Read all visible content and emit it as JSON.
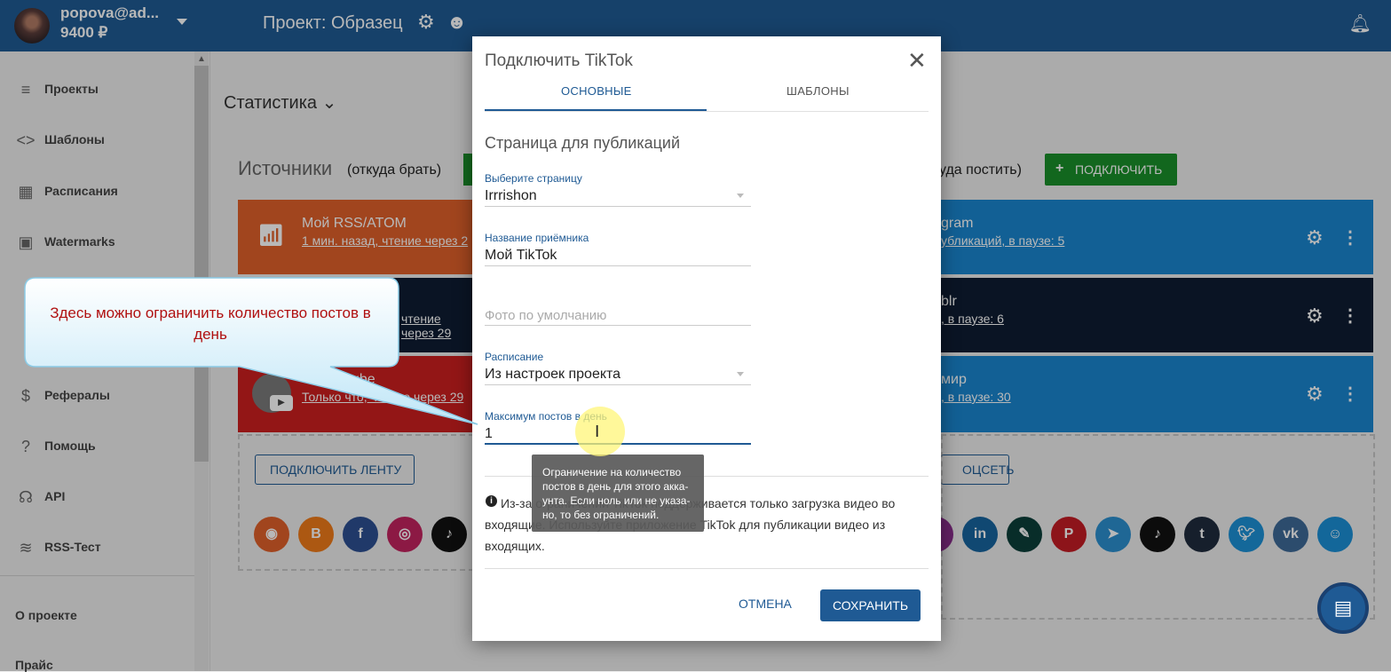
{
  "header": {
    "user": "popova@ad...",
    "balance": "9400 ₽",
    "project_title": "Проект: Образец"
  },
  "sidebar": {
    "items": [
      {
        "label": "Проекты",
        "icon": "list-icon"
      },
      {
        "label": "Шаблоны",
        "icon": "code-brackets-icon"
      },
      {
        "label": "Расписания",
        "icon": "calendar-icon"
      },
      {
        "label": "Watermarks",
        "icon": "watermark-icon"
      },
      {
        "label": "Рефералы",
        "icon": "dollar-icon"
      },
      {
        "label": "Помощь",
        "icon": "help-circle-icon"
      },
      {
        "label": "API",
        "icon": "antenna-icon"
      },
      {
        "label": "RSS-Тест",
        "icon": "rss-icon"
      }
    ],
    "about": "О проекте",
    "pricing": "Прайс"
  },
  "main": {
    "stats_title": "Статистика",
    "sources_title": "Источники",
    "sources_sub": "(откуда брать)",
    "dest_sub": "уда постить)",
    "connect_label": "ПОДКЛЮЧИТЬ",
    "sources": [
      {
        "title": "Мой RSS/ATOM",
        "sub": "1 мин. назад, чтение через 2",
        "color": "#e0602a"
      },
      {
        "title": "",
        "sub": "чтение через 29",
        "color": "#0f1d33"
      },
      {
        "title": "ube",
        "sub": "Только что, чтение через 29",
        "color": "#cc1f1f"
      }
    ],
    "destinations": [
      {
        "title": "gram",
        "sub": "убликаций, в паузе: 5",
        "color": "#1a86cf"
      },
      {
        "title": "blr",
        "sub": ", в паузе: 6",
        "color": "#0f1d33"
      },
      {
        "title": "мир",
        "sub": ", в паузе: 30",
        "color": "#1a86cf"
      }
    ],
    "connect_feed_label": "ПОДКЛЮЧИТЬ ЛЕНТУ",
    "connect_network_label": "ОЦСЕТЬ"
  },
  "modal": {
    "title": "Подключить TikTok",
    "tabs": [
      "ОСНОВНЫЕ",
      "ШАБЛОНЫ"
    ],
    "section_title": "Страница для публикаций",
    "page_label": "Выберите страницу",
    "page_value": "Irrrishon",
    "receiver_label": "Название приёмника",
    "receiver_value": "Мой TikTok",
    "photo_placeholder": "Фото по умолчанию",
    "schedule_label": "Расписание",
    "schedule_value": "Из настроек проекта",
    "max_label": "Максимум постов в день",
    "max_value": "1",
    "info_text": "Из-за ограничений TikTok поддерживается только загрузка видео во входящие. Используйте приложение TikTok для публикации видео из входящих.",
    "cancel_label": "ОТМЕНА",
    "save_label": "СОХРАНИТЬ"
  },
  "tooltip": "Ограничение на количество постов в день для этого акка-унта. Если ноль или не указа-но, то без ограничений.",
  "callout": "Здесь можно ограничить количество постов в день"
}
